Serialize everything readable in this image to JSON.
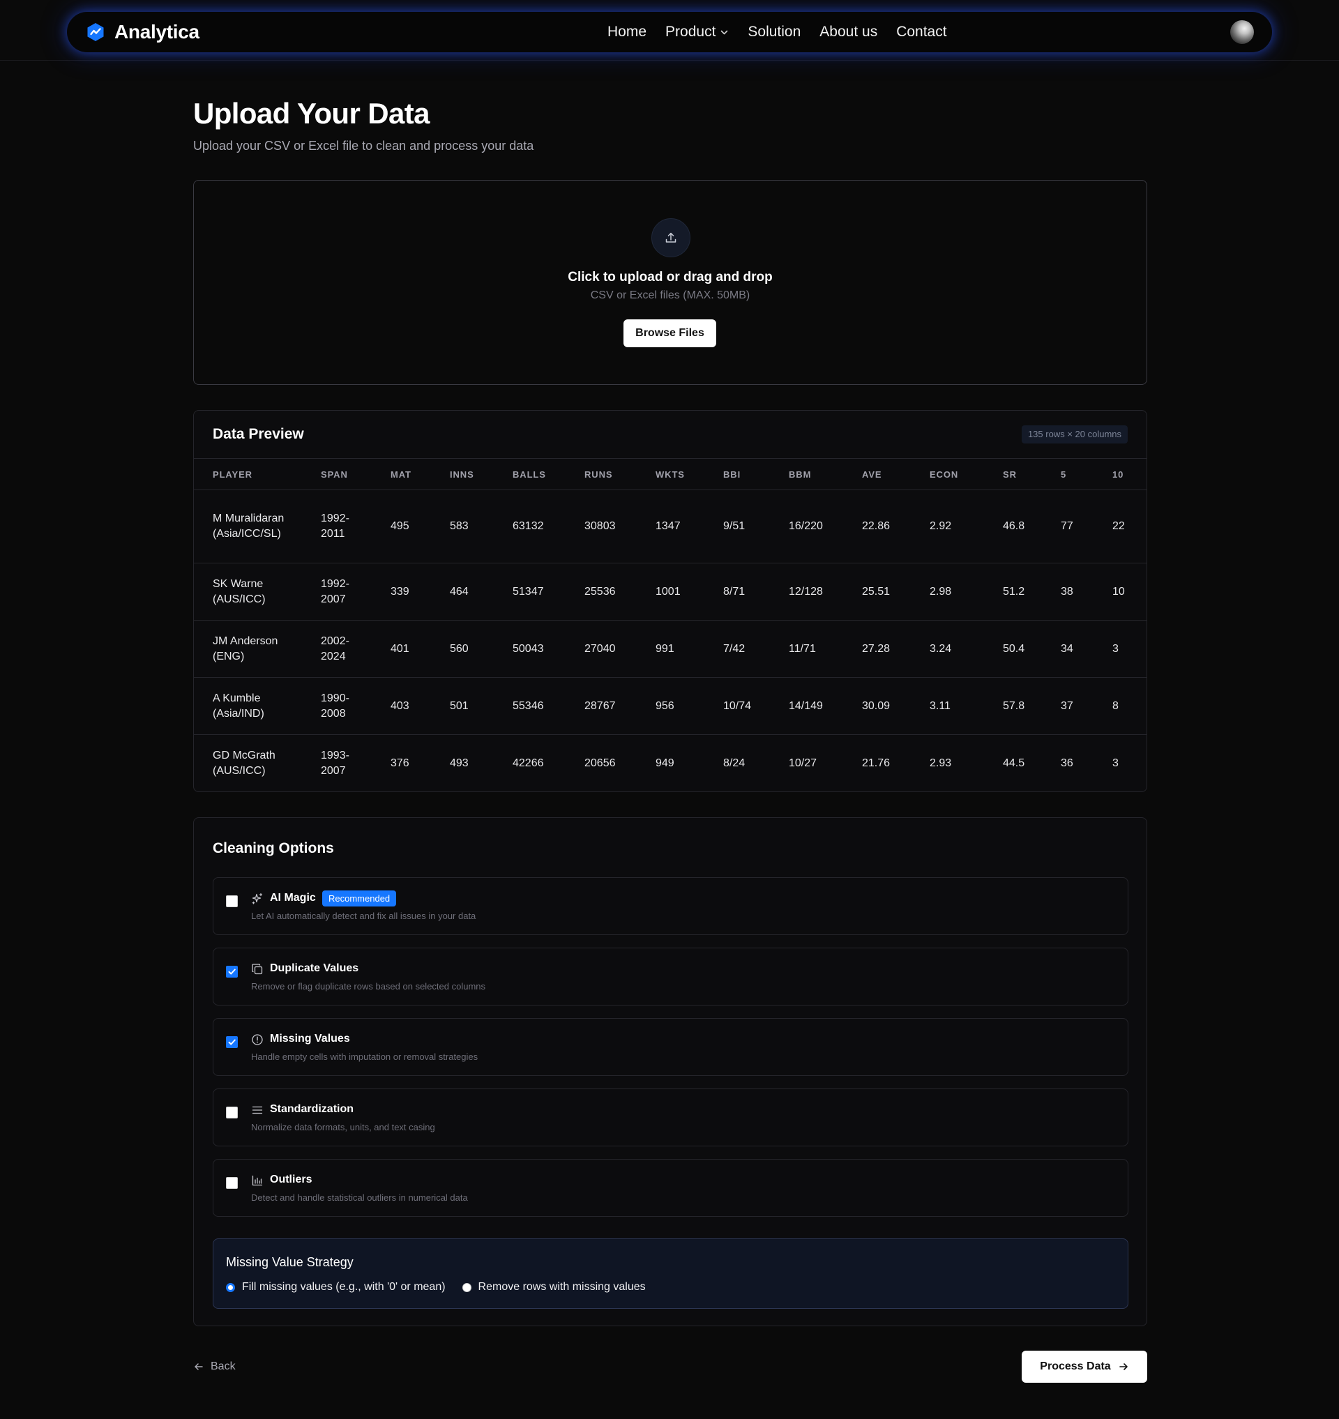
{
  "nav": {
    "brand": "Analytica",
    "links": [
      "Home",
      "Product",
      "Solution",
      "About us",
      "Contact"
    ]
  },
  "page": {
    "title": "Upload Your Data",
    "subtitle": "Upload your CSV or Excel file to clean and process your data"
  },
  "upload": {
    "title": "Click to upload or drag and drop",
    "hint": "CSV or Excel files (MAX. 50MB)",
    "browse_label": "Browse Files"
  },
  "preview": {
    "title": "Data Preview",
    "badge": "135 rows × 20 columns",
    "columns": [
      "PLAYER",
      "SPAN",
      "MAT",
      "INNS",
      "BALLS",
      "RUNS",
      "WKTS",
      "BBI",
      "BBM",
      "AVE",
      "ECON",
      "SR",
      "5",
      "10"
    ],
    "rows": [
      [
        "M Muralidaran (Asia/ICC/SL)",
        "1992-2011",
        "495",
        "583",
        "63132",
        "30803",
        "1347",
        "9/51",
        "16/220",
        "22.86",
        "2.92",
        "46.8",
        "77",
        "22"
      ],
      [
        "SK Warne (AUS/ICC)",
        "1992-2007",
        "339",
        "464",
        "51347",
        "25536",
        "1001",
        "8/71",
        "12/128",
        "25.51",
        "2.98",
        "51.2",
        "38",
        "10"
      ],
      [
        "JM Anderson (ENG)",
        "2002-2024",
        "401",
        "560",
        "50043",
        "27040",
        "991",
        "7/42",
        "11/71",
        "27.28",
        "3.24",
        "50.4",
        "34",
        "3"
      ],
      [
        "A Kumble (Asia/IND)",
        "1990-2008",
        "403",
        "501",
        "55346",
        "28767",
        "956",
        "10/74",
        "14/149",
        "30.09",
        "3.11",
        "57.8",
        "37",
        "8"
      ],
      [
        "GD McGrath (AUS/ICC)",
        "1993-2007",
        "376",
        "493",
        "42266",
        "20656",
        "949",
        "8/24",
        "10/27",
        "21.76",
        "2.93",
        "44.5",
        "36",
        "3"
      ]
    ]
  },
  "cleaning": {
    "title": "Cleaning Options",
    "options": [
      {
        "label": "AI Magic",
        "badge": "Recommended",
        "desc": "Let AI automatically detect and fix all issues in your data",
        "checked": false,
        "icon": "sparkles-icon"
      },
      {
        "label": "Duplicate Values",
        "desc": "Remove or flag duplicate rows based on selected columns",
        "checked": true,
        "icon": "copy-icon"
      },
      {
        "label": "Missing Values",
        "desc": "Handle empty cells with imputation or removal strategies",
        "checked": true,
        "icon": "alert-circle-icon"
      },
      {
        "label": "Standardization",
        "desc": "Normalize data formats, units, and text casing",
        "checked": false,
        "icon": "list-icon"
      },
      {
        "label": "Outliers",
        "desc": "Detect and handle statistical outliers in numerical data",
        "checked": false,
        "icon": "bar-chart-icon"
      }
    ],
    "strategy": {
      "title": "Missing Value Strategy",
      "options": [
        "Fill missing values (e.g., with '0' or mean)",
        "Remove rows with missing values"
      ],
      "selected": 0
    }
  },
  "footer": {
    "back_label": "Back",
    "process_label": "Process Data"
  },
  "colors": {
    "accent": "#1677ff",
    "background": "#0a0a0a",
    "card": "#0c0c0e",
    "strategy_bg": "#0f1524"
  }
}
